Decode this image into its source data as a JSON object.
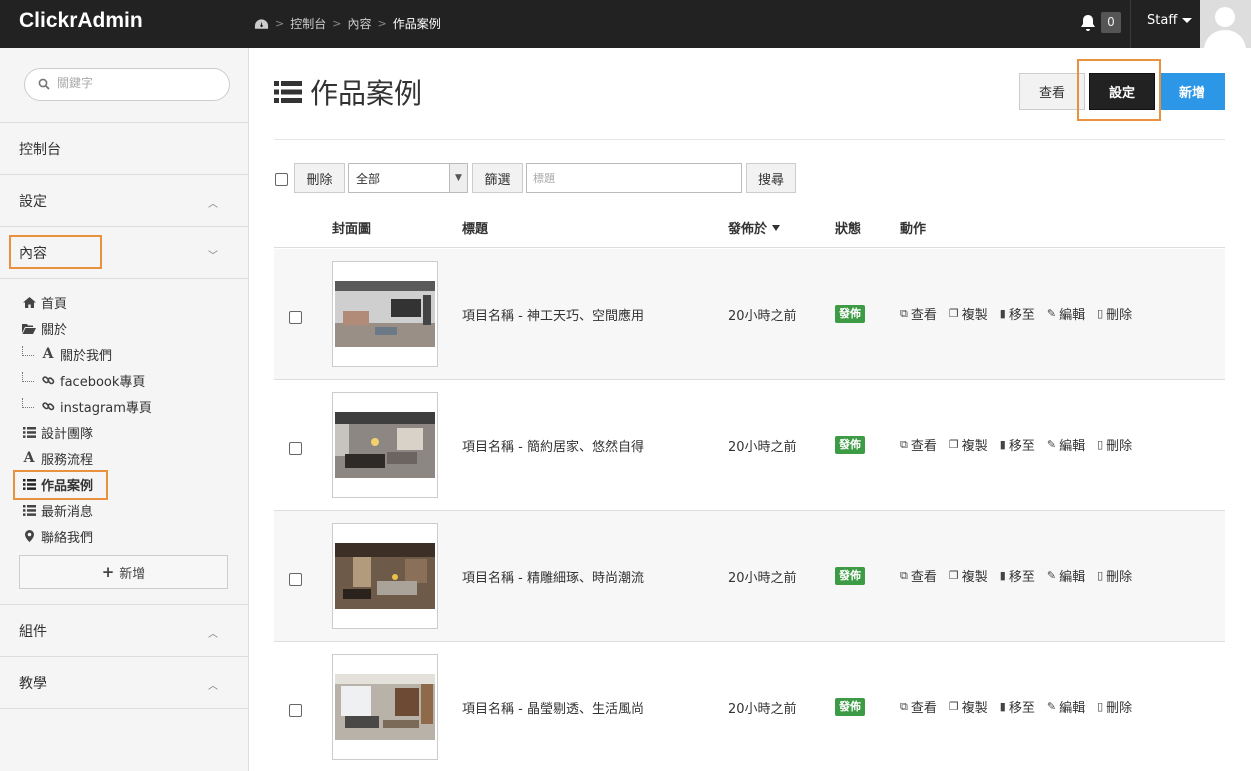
{
  "app": {
    "brand": "ClickrAdmin"
  },
  "breadcrumb": {
    "home_icon": "dashboard-icon",
    "items": [
      "控制台",
      "內容",
      "作品案例"
    ]
  },
  "header": {
    "notifications": "0",
    "user": "Staff"
  },
  "sidebar": {
    "search_placeholder": "關鍵字",
    "sections": [
      "控制台",
      "設定",
      "內容",
      "組件",
      "教學"
    ],
    "items": [
      {
        "label": "首頁",
        "icon": "home-icon"
      },
      {
        "label": "關於",
        "icon": "folder-open-icon"
      },
      {
        "label": "關於我們",
        "icon": "font-icon"
      },
      {
        "label": "facebook專頁",
        "icon": "link-icon"
      },
      {
        "label": "instagram專頁",
        "icon": "link-icon"
      },
      {
        "label": "設計團隊",
        "icon": "list-icon"
      },
      {
        "label": "服務流程",
        "icon": "font-icon"
      },
      {
        "label": "作品案例",
        "icon": "list-icon"
      },
      {
        "label": "最新消息",
        "icon": "list-icon"
      },
      {
        "label": "聯絡我們",
        "icon": "map-marker-icon"
      }
    ],
    "add_label": "新增"
  },
  "page": {
    "title": "作品案例",
    "buttons": {
      "view": "查看",
      "settings": "設定",
      "new": "新增"
    }
  },
  "toolbar": {
    "delete": "刪除",
    "filter_value": "全部",
    "filter_btn": "篩選",
    "keyword_placeholder": "標題",
    "search_btn": "搜尋"
  },
  "table": {
    "headers": {
      "cover": "封面圖",
      "title": "標題",
      "published": "發佈於",
      "status": "狀態",
      "actions": "動作"
    },
    "action_labels": {
      "view": "查看",
      "copy": "複製",
      "move": "移至",
      "edit": "編輯",
      "delete": "刪除"
    },
    "rows": [
      {
        "title": "項目名稱 - 神工天巧、空間應用",
        "time": "20小時之前",
        "status": "發佈"
      },
      {
        "title": "項目名稱 - 簡約居家、悠然自得",
        "time": "20小時之前",
        "status": "發佈"
      },
      {
        "title": "項目名稱 - 精雕細琢、時尚潮流",
        "time": "20小時之前",
        "status": "發佈"
      },
      {
        "title": "項目名稱 - 晶瑩剔透、生活風尚",
        "time": "20小時之前",
        "status": "發佈"
      }
    ]
  },
  "colors": {
    "accent": "#2b97e6",
    "highlight": "#e8913e",
    "status": "#3d9a45",
    "topbar": "#222222"
  }
}
